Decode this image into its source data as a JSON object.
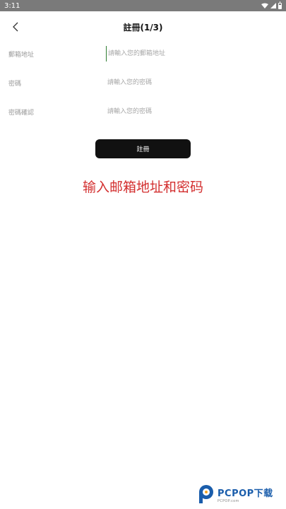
{
  "status_bar": {
    "time": "3:11"
  },
  "header": {
    "title": "註冊(1/3)"
  },
  "form": {
    "fields": [
      {
        "label": "郵箱地址",
        "placeholder": "請輸入您的郵箱地址",
        "value": ""
      },
      {
        "label": "密碼",
        "placeholder": "請輸入您的密碼",
        "value": ""
      },
      {
        "label": "密碼確認",
        "placeholder": "請輸入您的密碼",
        "value": ""
      }
    ],
    "submit_label": "註冊"
  },
  "caption": "输入邮箱地址和密码",
  "watermark": {
    "name": "PCPOP下载",
    "sub": "PCPOP.com"
  },
  "colors": {
    "caption": "#d32f2f",
    "button_bg": "#111111",
    "status_bar": "#7a7a7a",
    "cursor": "#2e7d32",
    "watermark": "#1a5dab"
  }
}
